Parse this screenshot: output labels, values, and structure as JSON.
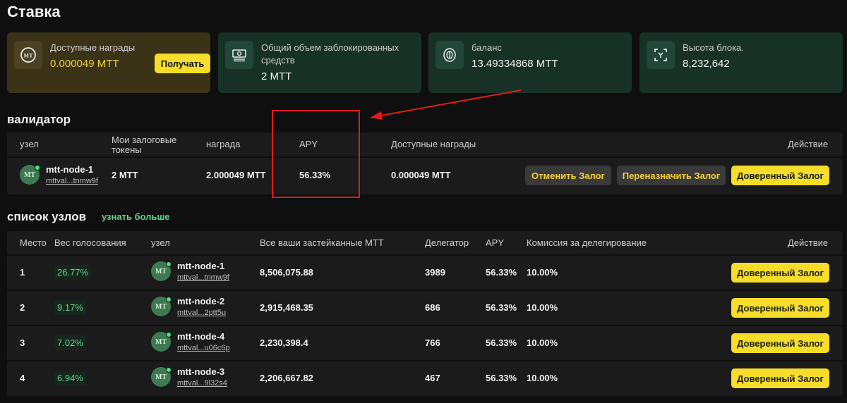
{
  "page_title": "Ставка",
  "cards": {
    "rewards": {
      "label": "Доступные награды",
      "value": "0.000049 MTT",
      "button": "Получать",
      "icon": "coin-icon"
    },
    "locked": {
      "label_line1": "Общий объем заблокированных",
      "label_line2": "средств",
      "value": "2 MTT",
      "icon": "banknote-icon"
    },
    "balance": {
      "label": "баланс",
      "value": "13.49334868 MTT",
      "icon": "coins-icon"
    },
    "block": {
      "label": "Высота блока.",
      "value": "8,232,642",
      "icon": "block-icon"
    }
  },
  "validator": {
    "title": "валидатор",
    "headers": {
      "node": "узел",
      "stake_line1": "Мои залоговые",
      "stake_line2": "токены",
      "reward": "награда",
      "apy": "APY",
      "available": "Доступные награды",
      "action": "Действие"
    },
    "row": {
      "avatar": "MT",
      "name": "mtt-node-1",
      "address": "mttval...tnmw9f",
      "stake": "2 MTT",
      "reward": "2.000049 MTT",
      "apy": "56.33%",
      "available": "0.000049 MTT",
      "cancel_btn": "Отменить Залог",
      "reassign_btn": "Переназначить Залог",
      "trust_btn": "Доверенный Залог"
    }
  },
  "nodes": {
    "title": "список узлов",
    "learn_more": "узнать больше",
    "headers": {
      "rank": "Место",
      "weight": "Вес голосования",
      "node": "узел",
      "staked": "Все ваши застейканные MTT",
      "delegators": "Делегатор",
      "apy": "APY",
      "commission": "Комиссия за делегирование",
      "action": "Действие"
    },
    "rows": [
      {
        "rank": "1",
        "weight": "26.77%",
        "avatar": "MT",
        "name": "mtt-node-1",
        "address": "mttval...tnmw9f",
        "staked": "8,506,075.88",
        "delegators": "3989",
        "apy": "56.33%",
        "commission": "10.00%",
        "button": "Доверенный Залог"
      },
      {
        "rank": "2",
        "weight": "9.17%",
        "avatar": "MT",
        "name": "mtt-node-2",
        "address": "mttval...2ptt5u",
        "staked": "2,915,468.35",
        "delegators": "686",
        "apy": "56.33%",
        "commission": "10.00%",
        "button": "Доверенный Залог"
      },
      {
        "rank": "3",
        "weight": "7.02%",
        "avatar": "MT",
        "name": "mtt-node-4",
        "address": "mttval...u06c6p",
        "staked": "2,230,398.4",
        "delegators": "766",
        "apy": "56.33%",
        "commission": "10.00%",
        "button": "Доверенный Залог"
      },
      {
        "rank": "4",
        "weight": "6.94%",
        "avatar": "MT",
        "name": "mtt-node-3",
        "address": "mttval...9l32s4",
        "staked": "2,206,667.82",
        "delegators": "467",
        "apy": "56.33%",
        "commission": "10.00%",
        "button": "Доверенный Залог"
      }
    ]
  },
  "colors": {
    "accent_yellow": "#f5dd29",
    "green_text": "#5fd48a",
    "annotation_red": "#e01b1b"
  }
}
